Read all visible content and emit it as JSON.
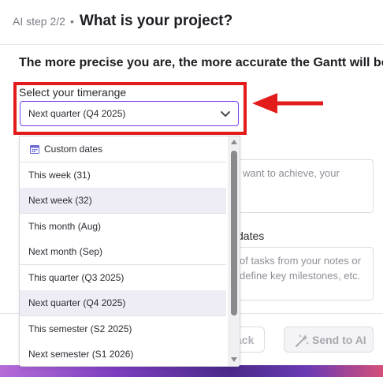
{
  "header": {
    "step": "AI step 2/2",
    "separator": "•",
    "title": "What is your project?"
  },
  "heading": "The more precise you are, the more accurate the Gantt will be",
  "timerange": {
    "label": "Select your timerange",
    "selected": "Next quarter (Q4 2025)"
  },
  "dropdown": {
    "items": [
      {
        "label": "Custom dates",
        "icon": "calendar-icon"
      },
      {
        "label": "This week (31)"
      },
      {
        "label": "Next week (32)"
      },
      {
        "label": "This month (Aug)"
      },
      {
        "label": "Next month (Sep)"
      },
      {
        "label": "This quarter (Q3 2025)"
      },
      {
        "label": "Next quarter (Q4 2025)"
      },
      {
        "label": "This semester (S2 2025)"
      },
      {
        "label": "Next semester (S1 2026)"
      }
    ]
  },
  "goal_field": {
    "placeholder_fragment": "want to achieve, your"
  },
  "dates_section": {
    "label_fragment": "dates",
    "placeholder_line1": "of tasks from your notes or",
    "placeholder_line2": "define key milestones, etc."
  },
  "footer": {
    "back_label": "ack",
    "send_label": "Send to AI"
  },
  "colors": {
    "accent": "#7c3aed",
    "annotation_red": "#e21b1b"
  }
}
